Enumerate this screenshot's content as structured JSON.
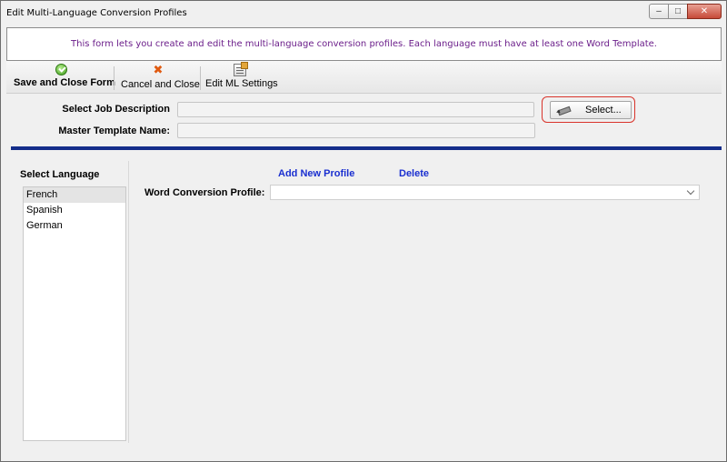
{
  "window": {
    "title": "Edit Multi-Language Conversion Profiles",
    "controls": {
      "minimize": "–",
      "maximize": "□",
      "close": "✕"
    }
  },
  "info": {
    "message": "This form lets you create and edit the multi-language conversion profiles. Each language must have at least one Word Template."
  },
  "toolbar": {
    "save_label": "Save and Close Form",
    "cancel_label": "Cancel and Close",
    "edit_ml_label": "Edit ML Settings"
  },
  "form": {
    "job_description_label": "Select Job Description",
    "job_description_value": "",
    "select_button_label": "Select...",
    "master_template_label": "Master Template Name:",
    "master_template_value": ""
  },
  "languages": {
    "title": "Select Language",
    "items": [
      {
        "label": "French",
        "selected": true
      },
      {
        "label": "Spanish",
        "selected": false
      },
      {
        "label": "German",
        "selected": false
      }
    ]
  },
  "profile": {
    "add_new_label": "Add New Profile",
    "delete_label": "Delete",
    "word_conversion_label": "Word Conversion Profile:",
    "word_conversion_value": ""
  },
  "colors": {
    "accent_rule": "#142d8a",
    "link": "#1a2fd0",
    "info_text": "#6b1e8a",
    "highlight": "#d9342b"
  }
}
